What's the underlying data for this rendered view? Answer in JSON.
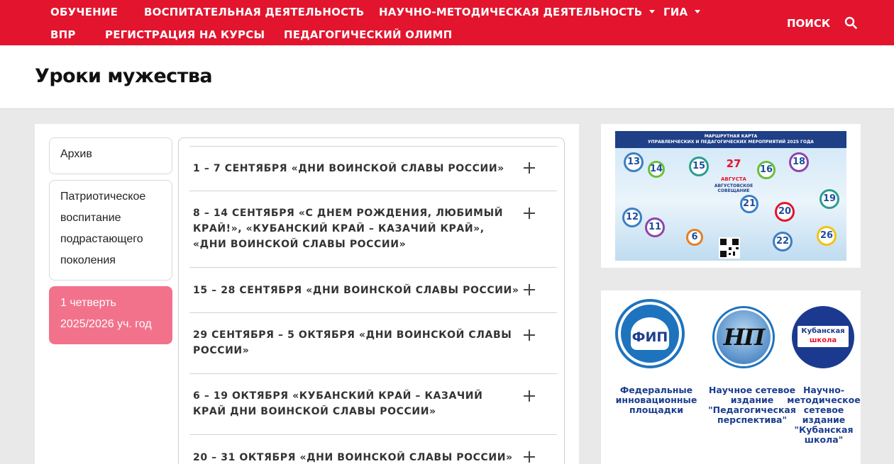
{
  "nav": {
    "row1": [
      "ОБУЧЕНИЕ",
      "ВОСПИТАТЕЛЬНАЯ ДЕЯТЕЛЬНОСТЬ",
      "НАУЧНО-МЕТОДИЧЕСКАЯ ДЕЯТЕЛЬНОСТЬ",
      "ГИА"
    ],
    "row2": [
      "ВПР",
      "РЕГИСТРАЦИЯ НА КУРСЫ",
      "ПЕДАГОГИЧЕСКИЙ ОЛИМП"
    ],
    "search_label": "ПОИСК",
    "accent_color": "#e3142d"
  },
  "page": {
    "title": "Уроки мужества"
  },
  "sidebar": {
    "items": [
      "Архив",
      "Патриотическое воспитание подрастающего поколения",
      "1 четверть 2025/2026 уч. год"
    ],
    "active_color": "#f2728c"
  },
  "accordion": {
    "items": [
      "1 – 7 сентября «Дни воинской славы России»",
      "8 – 14 сентября «С Днем рождения, любимый край!», «Кубанский край – казачий край», «Дни воинской славы России»",
      "15 – 28 сентября «Дни воинской славы России»",
      "29 сентября – 5 октября «Дни воинской славы России»",
      "6 – 19 октября «Кубанский край – казачий край Дни воинской славы России»",
      "20 – 31 октября «Дни воинской славы России»"
    ]
  },
  "banner": {
    "heading_1": "МАРШРУТНАЯ КАРТА",
    "heading_2": "УПРАВЛЕНЧЕСКИХ И ПЕДАГОГИЧЕСКИХ МЕРОПРИЯТИЙ 2025 ГОДА",
    "aug_day": "27",
    "aug_month": "АВГУСТА",
    "aug_event": "АВГУСТОВСКОЕ СОВЕЩАНИЕ",
    "numbers": [
      "13",
      "14",
      "15",
      "16",
      "18",
      "19",
      "12",
      "11",
      "6",
      "21",
      "20",
      "22",
      "26"
    ]
  },
  "links": {
    "fip_logo": "ФИП",
    "np_logo": "НП",
    "ks_logo_1": "Кубанская",
    "ks_logo_2": "школа",
    "captions": [
      "Федеральные инновационные площадки",
      "Научное сетевое издание \"Педагогическая перспектива\"",
      "Научно-методическое сетевое издание \"Кубанская школа\""
    ]
  }
}
